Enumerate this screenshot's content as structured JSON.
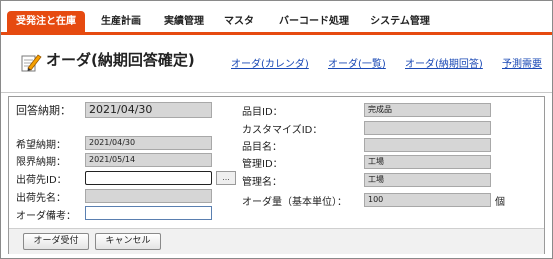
{
  "tabs": [
    {
      "label": "受発注と在庫",
      "active": true
    },
    {
      "label": "生産計画",
      "active": false
    },
    {
      "label": "実績管理",
      "active": false
    },
    {
      "label": "マスタ",
      "active": false
    },
    {
      "label": "バーコード処理",
      "active": false
    },
    {
      "label": "システム管理",
      "active": false
    }
  ],
  "page": {
    "title": "オーダ(納期回答確定)",
    "icon": "pencil-note-icon"
  },
  "nav_links": [
    "オーダ(カレンダ)",
    "オーダ(一覧)",
    "オーダ(納期回答)",
    "予測需要"
  ],
  "form": {
    "reply_date_label": "回答納期：",
    "reply_date_value": "2021/04/30",
    "desired_date_label": "希望納期：",
    "desired_date_value": "2021/04/30",
    "limit_date_label": "限界納期：",
    "limit_date_value": "2021/05/14",
    "ship_to_id_label": "出荷先ID：",
    "ship_to_id_value": "",
    "lookup_button_label": "...",
    "ship_to_name_label": "出荷先名：",
    "ship_to_name_value": "",
    "order_note_label": "オーダ備考：",
    "order_note_value": "",
    "item_id_label": "品目ID：",
    "item_id_value": "完成品",
    "customize_id_label": "カスタマイズID：",
    "customize_id_value": "",
    "item_name_label": "品目名：",
    "item_name_value": "",
    "mgmt_id_label": "管理ID：",
    "mgmt_id_value": "工場",
    "mgmt_name_label": "管理名：",
    "mgmt_name_value": "工場",
    "order_qty_label": "オーダ量（基本単位）：",
    "order_qty_value": "100",
    "unit_label": "個"
  },
  "buttons": {
    "accept": "オーダ受付",
    "cancel": "キャンセル"
  },
  "colors": {
    "accent": "#e64a10",
    "link": "#1a49b5"
  }
}
